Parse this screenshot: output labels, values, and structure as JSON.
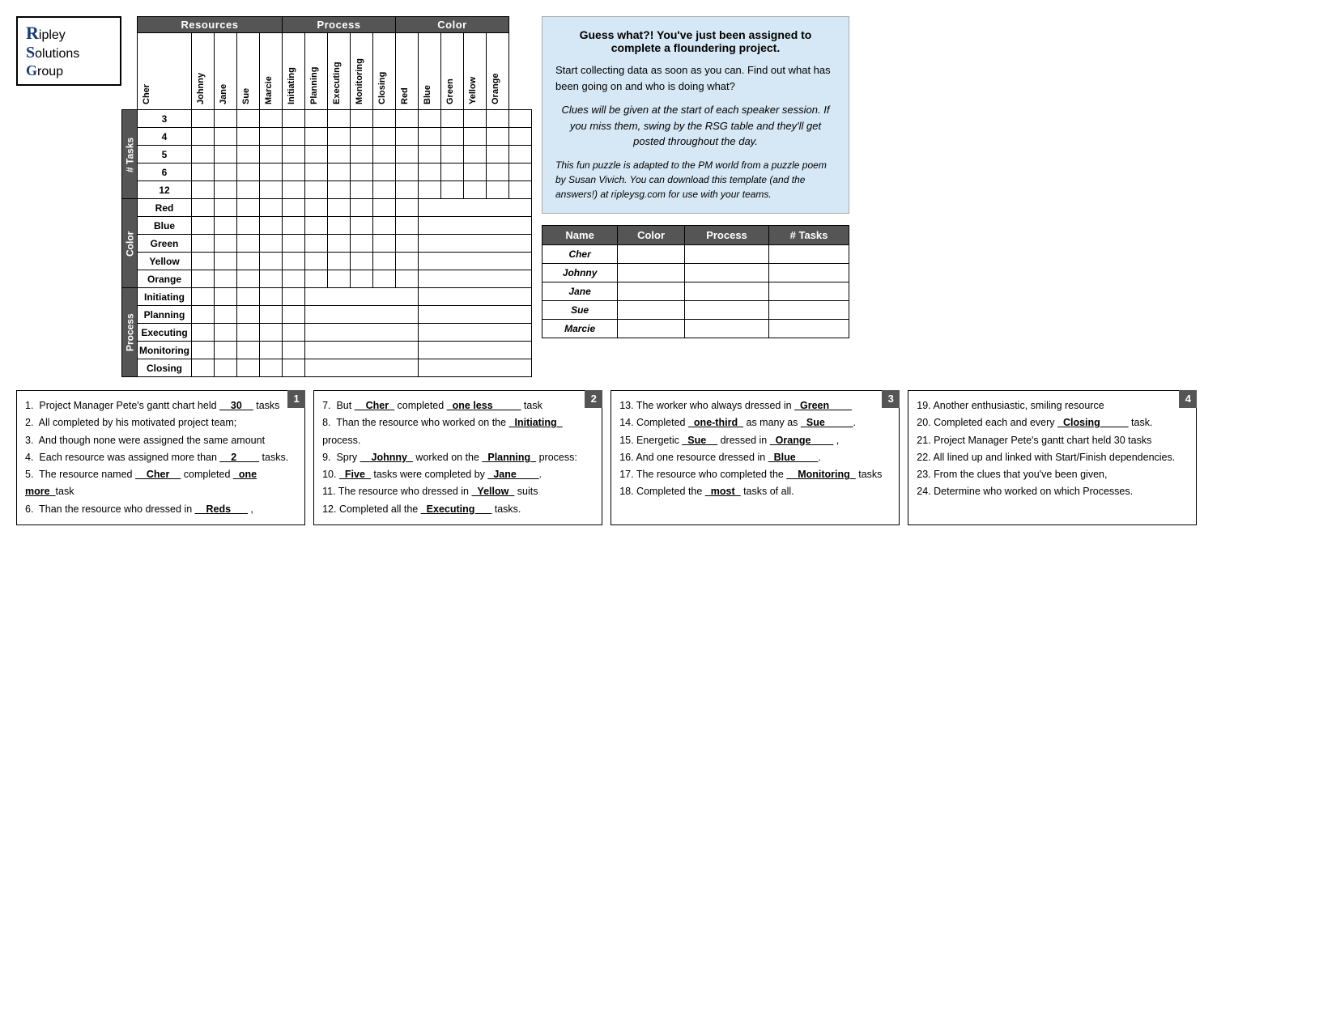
{
  "logo": {
    "line1": "ipley",
    "line2": "olutions",
    "line3": "roup"
  },
  "headers": {
    "resources": "Resources",
    "process": "Process",
    "color": "Color"
  },
  "col_headers": {
    "resources": [
      "Cher",
      "Johnny",
      "Jane",
      "Sue",
      "Marcie"
    ],
    "process": [
      "Initiating",
      "Planning",
      "Executing",
      "Monitoring",
      "Closing"
    ],
    "color": [
      "Red",
      "Blue",
      "Green",
      "Yellow",
      "Orange"
    ]
  },
  "row_sections": {
    "tasks_label": "# Tasks",
    "tasks_rows": [
      "3",
      "4",
      "5",
      "6",
      "12"
    ],
    "color_label": "Color",
    "color_rows": [
      "Red",
      "Blue",
      "Green",
      "Yellow",
      "Orange"
    ],
    "process_label": "Process",
    "process_rows": [
      "Initiating",
      "Planning",
      "Executing",
      "Monitoring",
      "Closing"
    ]
  },
  "summary_table": {
    "headers": [
      "Name",
      "Color",
      "Process",
      "# Tasks"
    ],
    "rows": [
      {
        "name": "Cher",
        "color": "",
        "process": "",
        "tasks": ""
      },
      {
        "name": "Johnny",
        "color": "",
        "process": "",
        "tasks": ""
      },
      {
        "name": "Jane",
        "color": "",
        "process": "",
        "tasks": ""
      },
      {
        "name": "Sue",
        "color": "",
        "process": "",
        "tasks": ""
      },
      {
        "name": "Marcie",
        "color": "",
        "process": "",
        "tasks": ""
      }
    ]
  },
  "info_box": {
    "headline": "Guess what?! You've just been assigned to complete a floundering project.",
    "subtext": "Start collecting data as soon as you can.  Find out what has been going on and who is doing what?",
    "italic1": "Clues will be given at the start of each speaker session.  If you miss them, swing by the RSG table and they'll get posted throughout the day.",
    "footer": "This fun puzzle is adapted to the PM world from a puzzle poem by Susan Vivich.  You can download this template (and the answers!) at ripleysg.com for use with your teams."
  },
  "clue_boxes": {
    "box1": {
      "number": "1",
      "clues": [
        "1.  Project Manager Pete's gantt chart held __30__ tasks",
        "2.  All completed by his motivated project team;",
        "3.  And though none were assigned the same amount",
        "4.  Each resource was assigned more than __2____ tasks.",
        "5.  The resource named __Cher__ completed _one more_task",
        "6.  Than the resource who dressed in __Reds___ ,"
      ]
    },
    "box2": {
      "number": "2",
      "clues": [
        "7.  But __Cher_ completed _one less_____ task",
        "8.  Than the resource who worked on the _Initiating_ process.",
        "9.  Spry __Johnny_ worked on the _Planning_ process:",
        "10. _Five_ tasks were completed by _Jane____.",
        "11. The resource who dressed in _Yellow_ suits",
        "12. Completed all the _Executing___ tasks."
      ]
    },
    "box3": {
      "number": "3",
      "clues": [
        "13. The worker who always dressed in _Green____",
        "14. Completed _one-third_ as many as _Sue_____.",
        "15. Energetic _Sue__ dressed in _Orange____ ,",
        "16. And one resource dressed in _Blue____.",
        "17. The resource who completed the __Monitoring_ tasks",
        "18. Completed the _most_ tasks of all."
      ]
    },
    "box4": {
      "number": "4",
      "clues": [
        "19. Another enthusiastic, smiling resource",
        "20. Completed each and every _Closing____ task.",
        "21. Project Manager Pete's gantt chart held 30 tasks",
        "22. All lined up and linked with Start/Finish dependencies.",
        "23. From the clues that you've been given,",
        "24. Determine who worked on which Processes."
      ]
    }
  }
}
